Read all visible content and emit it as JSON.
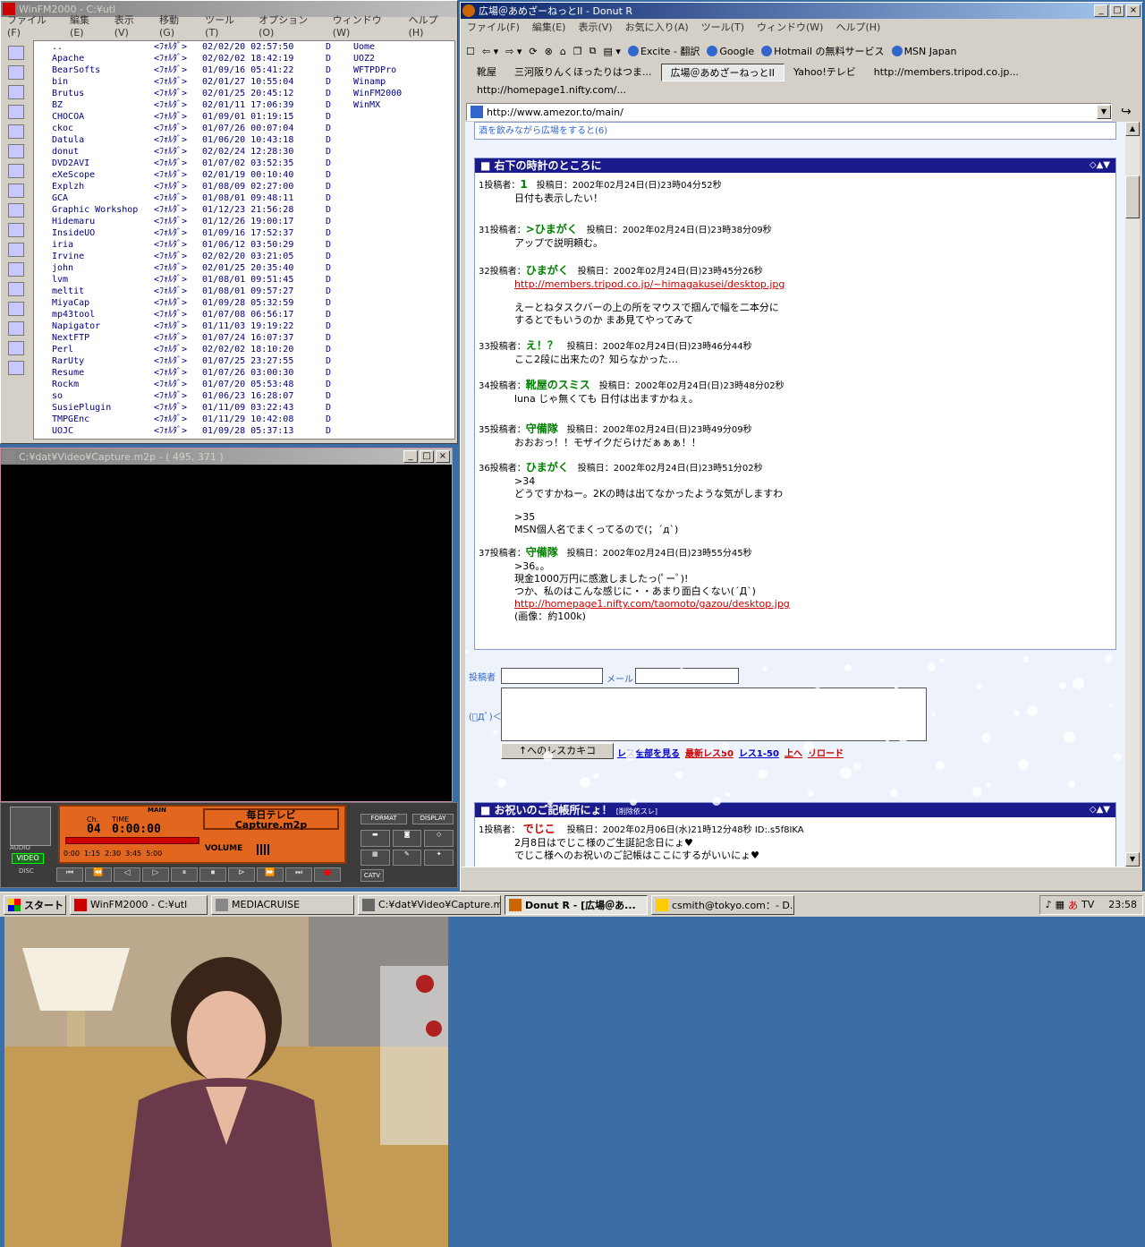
{
  "winfm": {
    "title": "WinFM2000 - C:¥utl",
    "menu": [
      "ファイル(F)",
      "編集(E)",
      "表示(V)",
      "移動(G)",
      "ツール(T)",
      "オプション(O)",
      "ウィンドウ(W)",
      "ヘルプ(H)"
    ],
    "files": [
      {
        "name": "..",
        "type": "<ﾌｫﾙﾀﾞ>",
        "date": "02/02/20 02:57:50",
        "attr": "D"
      },
      {
        "name": "Apache",
        "type": "<ﾌｫﾙﾀﾞ>",
        "date": "02/02/02 18:42:19",
        "attr": "D"
      },
      {
        "name": "BearSofts",
        "type": "<ﾌｫﾙﾀﾞ>",
        "date": "01/09/16 05:41:22",
        "attr": "D"
      },
      {
        "name": "bin",
        "type": "<ﾌｫﾙﾀﾞ>",
        "date": "02/01/27 10:55:04",
        "attr": "D"
      },
      {
        "name": "Brutus",
        "type": "<ﾌｫﾙﾀﾞ>",
        "date": "02/01/25 20:45:12",
        "attr": "D"
      },
      {
        "name": "BZ",
        "type": "<ﾌｫﾙﾀﾞ>",
        "date": "02/01/11 17:06:39",
        "attr": "D"
      },
      {
        "name": "CHOCOA",
        "type": "<ﾌｫﾙﾀﾞ>",
        "date": "01/09/01 01:19:15",
        "attr": "D"
      },
      {
        "name": "ckoc",
        "type": "<ﾌｫﾙﾀﾞ>",
        "date": "01/07/26 00:07:04",
        "attr": "D"
      },
      {
        "name": "Datula",
        "type": "<ﾌｫﾙﾀﾞ>",
        "date": "01/06/20 10:43:18",
        "attr": "D"
      },
      {
        "name": "donut",
        "type": "<ﾌｫﾙﾀﾞ>",
        "date": "02/02/24 12:28:30",
        "attr": "D"
      },
      {
        "name": "DVD2AVI",
        "type": "<ﾌｫﾙﾀﾞ>",
        "date": "01/07/02 03:52:35",
        "attr": "D"
      },
      {
        "name": "eXeScope",
        "type": "<ﾌｫﾙﾀﾞ>",
        "date": "02/01/19 00:10:40",
        "attr": "D"
      },
      {
        "name": "Explzh",
        "type": "<ﾌｫﾙﾀﾞ>",
        "date": "01/08/09 02:27:00",
        "attr": "D"
      },
      {
        "name": "GCA",
        "type": "<ﾌｫﾙﾀﾞ>",
        "date": "01/08/01 09:48:11",
        "attr": "D"
      },
      {
        "name": "Graphic Workshop",
        "type": "<ﾌｫﾙﾀﾞ>",
        "date": "01/12/23 21:56:28",
        "attr": "D"
      },
      {
        "name": "Hidemaru",
        "type": "<ﾌｫﾙﾀﾞ>",
        "date": "01/12/26 19:00:17",
        "attr": "D"
      },
      {
        "name": "InsideUO",
        "type": "<ﾌｫﾙﾀﾞ>",
        "date": "01/09/16 17:52:37",
        "attr": "D"
      },
      {
        "name": "iria",
        "type": "<ﾌｫﾙﾀﾞ>",
        "date": "01/06/12 03:50:29",
        "attr": "D"
      },
      {
        "name": "Irvine",
        "type": "<ﾌｫﾙﾀﾞ>",
        "date": "02/02/20 03:21:05",
        "attr": "D"
      },
      {
        "name": "john",
        "type": "<ﾌｫﾙﾀﾞ>",
        "date": "02/01/25 20:35:40",
        "attr": "D"
      },
      {
        "name": "lvm",
        "type": "<ﾌｫﾙﾀﾞ>",
        "date": "01/08/01 09:51:45",
        "attr": "D"
      },
      {
        "name": "meltit",
        "type": "<ﾌｫﾙﾀﾞ>",
        "date": "01/08/01 09:57:27",
        "attr": "D"
      },
      {
        "name": "MiyaCap",
        "type": "<ﾌｫﾙﾀﾞ>",
        "date": "01/09/28 05:32:59",
        "attr": "D"
      },
      {
        "name": "mp43tool",
        "type": "<ﾌｫﾙﾀﾞ>",
        "date": "01/07/08 06:56:17",
        "attr": "D"
      },
      {
        "name": "Napigator",
        "type": "<ﾌｫﾙﾀﾞ>",
        "date": "01/11/03 19:19:22",
        "attr": "D"
      },
      {
        "name": "NextFTP",
        "type": "<ﾌｫﾙﾀﾞ>",
        "date": "01/07/24 16:07:37",
        "attr": "D"
      },
      {
        "name": "Perl",
        "type": "<ﾌｫﾙﾀﾞ>",
        "date": "02/02/02 18:10:20",
        "attr": "D"
      },
      {
        "name": "RarUty",
        "type": "<ﾌｫﾙﾀﾞ>",
        "date": "01/07/25 23:27:55",
        "attr": "D"
      },
      {
        "name": "Resume",
        "type": "<ﾌｫﾙﾀﾞ>",
        "date": "01/07/26 03:00:30",
        "attr": "D"
      },
      {
        "name": "Rockm",
        "type": "<ﾌｫﾙﾀﾞ>",
        "date": "01/07/20 05:53:48",
        "attr": "D"
      },
      {
        "name": "so",
        "type": "<ﾌｫﾙﾀﾞ>",
        "date": "01/06/23 16:28:07",
        "attr": "D"
      },
      {
        "name": "SusiePlugin",
        "type": "<ﾌｫﾙﾀﾞ>",
        "date": "01/11/09 03:22:43",
        "attr": "D"
      },
      {
        "name": "TMPGEnc",
        "type": "<ﾌｫﾙﾀﾞ>",
        "date": "01/11/29 10:42:08",
        "attr": "D"
      },
      {
        "name": "UOJC",
        "type": "<ﾌｫﾙﾀﾞ>",
        "date": "01/09/28 05:37:13",
        "attr": "D"
      }
    ],
    "column2": [
      "Uome",
      "UOZ2",
      "WFTPDPro",
      "Winamp",
      "WinFM2000",
      "WinMX"
    ],
    "column2_attr": [
      "D",
      "D",
      "D",
      "D",
      "D",
      "D"
    ]
  },
  "video": {
    "title": "C:¥dat¥Video¥Capture.m2p - ( 495, 371 )"
  },
  "mediacruise": {
    "main": "MAIN",
    "ch_label": "Ch.",
    "time_label": "TIME",
    "channel": "04",
    "time": "0:00:00",
    "station": "毎日テレビ",
    "file": "Capture.m2p",
    "ticks": "0:00  1:15  2:30  3:45  5:00",
    "volume": "VOLUME",
    "audio": "AUDIO",
    "video": "VIDEO",
    "disc": "DISC",
    "format": "FORMAT",
    "display": "DISPLAY",
    "catv": "CATV"
  },
  "browser": {
    "title": "広場＠あめざーねっとII - Donut R",
    "menu": [
      "ファイル(F)",
      "編集(E)",
      "表示(V)",
      "お気に入り(A)",
      "ツール(T)",
      "ウィンドウ(W)",
      "ヘルプ(H)"
    ],
    "links": [
      "Excite - 翻訳",
      "Google",
      "Hotmail の無料サービス",
      "MSN Japan"
    ],
    "tabs": [
      "靴屋",
      "三河阪りんくほったりはつま...",
      "広場＠あめざーねっとII",
      "Yahoo!テレビ",
      "http://members.tripod.co.jp...",
      "http://homepage1.nifty.com/..."
    ],
    "address": "http://www.amezor.to/main/",
    "top_link": "酒を飲みながら広場をすると(6)",
    "thread1_title": "■ 右下の時計のところに",
    "thread1_ctrl": "◇▲▼",
    "posts": [
      {
        "no": "1投稿者：",
        "name": "1",
        "date": "投稿日：2002年02月24日(日)23時04分52秒",
        "lines": [
          "日付も表示したい！"
        ]
      },
      {
        "no": "31投稿者：",
        "name": ">ひまがく",
        "date": "投稿日：2002年02月24日(日)23時38分09秒",
        "lines": [
          "アップで説明頼む。"
        ]
      },
      {
        "no": "32投稿者：",
        "name": "ひまがく",
        "date": "投稿日：2002年02月24日(日)23時45分26秒",
        "link": "http://members.tripod.co.jp/~himagakusei/desktop.jpg",
        "lines": [
          "えーとねタスクバーの上の所をマウスで掴んで幅を二本分に",
          "するとでもいうのか  まあ見てやってみて"
        ]
      },
      {
        "no": "33投稿者：",
        "name": "え！？",
        "date": "投稿日：2002年02月24日(日)23時46分44秒",
        "lines": [
          "ここ2段に出来たの？知らなかった…"
        ]
      },
      {
        "no": "34投稿者：",
        "name": "靴屋のスミス",
        "date": "投稿日：2002年02月24日(日)23時48分02秒",
        "lines": [
          "luna じゃ無くても 日付は出ますかねぇ。"
        ]
      },
      {
        "no": "35投稿者：",
        "name": "守備隊",
        "date": "投稿日：2002年02月24日(日)23時49分09秒",
        "lines": [
          "おおおっ！！モザイクだらけだぁぁぁ！！"
        ]
      },
      {
        "no": "36投稿者：",
        "name": "ひまがく",
        "date": "投稿日：2002年02月24日(日)23時51分02秒",
        "lines": [
          ">34",
          "どうですかねー。2Kの時は出てなかったような気がしますわ",
          "",
          ">35",
          "MSN個人名でまくってるので(；´д`)"
        ]
      },
      {
        "no": "37投稿者：",
        "name": "守備隊",
        "date": "投稿日：2002年02月24日(日)23時55分45秒",
        "lines": [
          ">36。。",
          "現金1000万円に感激しましたっ(ﾟーﾟ)!",
          "つか、私のはこんな感じに・・あまり面白くない(´Д`)"
        ],
        "link": "http://homepage1.nifty.com/taomoto/gazou/desktop.jpg",
        "after": "(画像：約100k)"
      }
    ],
    "form": {
      "author_label": "投稿者",
      "mail_label": "メール",
      "face": "(ﾟДﾟ)＜",
      "submit": "↑へのレスカキコ",
      "nav": [
        "レス全部を見る",
        "最新レス50",
        "レス1-50",
        "上へ",
        "リロード"
      ]
    },
    "thread2_title": "■ お祝いのご記帳所にょ！",
    "thread2_small": "[削除依スレ]",
    "post2": {
      "no": "1投稿者：",
      "name": "でじこ",
      "date": "投稿日：2002年02月06日(水)21時12分48秒 ID:.s5f8IKA",
      "lines": [
        "2月8日はでじこ様のご生誕記念日にょ♥",
        "でじこ様へのお祝いのご記帳はここにするがいいにょ♥"
      ]
    }
  },
  "taskbar": {
    "start": "スタート",
    "tasks": [
      "WinFM2000 - C:¥utl",
      "MEDIACRUISE",
      "C:¥dat¥Video¥Capture.m2...",
      "Donut R - [広場＠あ...",
      "csmith@tokyo.com：- D..."
    ],
    "clock": "23:58",
    "tv": "TV"
  },
  "colors": {
    "title_active": "#0a246a",
    "desktop": "#3a6ea5",
    "thread_head": "#1a1a8c",
    "post_name": "#008000",
    "link": "#cc0000"
  }
}
